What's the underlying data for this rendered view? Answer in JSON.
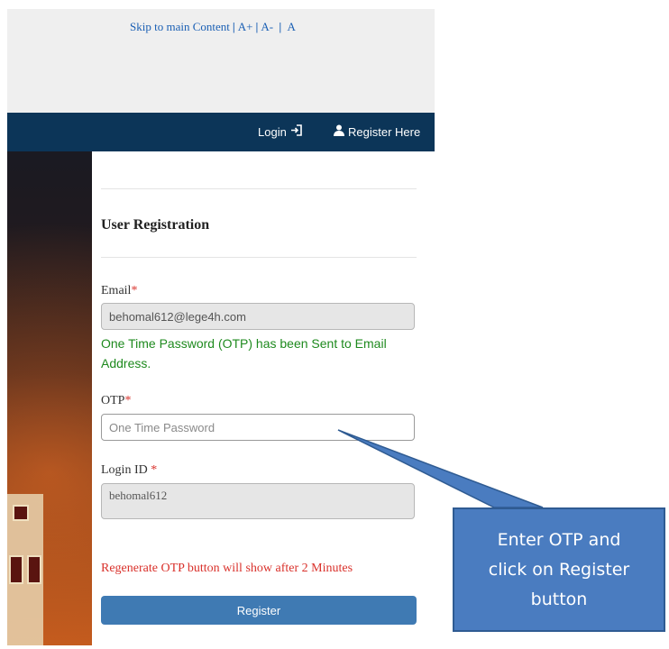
{
  "accessibility": {
    "skip_link": "Skip to main Content",
    "increase": "A+",
    "decrease": "A-",
    "reset": "A"
  },
  "nav": {
    "login_label": "Login",
    "register_label": "Register Here"
  },
  "form": {
    "title": "User Registration",
    "email": {
      "label": "Email",
      "required_mark": "*",
      "value": "behomal612@lege4h.com"
    },
    "otp_message": "One Time Password (OTP) has been Sent to Email Address.",
    "otp": {
      "label": "OTP",
      "required_mark": "*",
      "placeholder": "One Time Password"
    },
    "login_id": {
      "label": "Login ID",
      "required_mark": "*",
      "value": "behomal612"
    },
    "regenerate_notice": "Regenerate OTP button will show after 2 Minutes",
    "register_button": "Register"
  },
  "callout": {
    "text": "Enter OTP and click on Register button"
  },
  "colors": {
    "navbar": "#0c3558",
    "button": "#3f7ab3",
    "success": "#1e8a1e",
    "error": "#d9312b",
    "callout": "#4a7cc0"
  },
  "icons": {
    "login": "sign-in-icon",
    "register": "user-icon"
  }
}
